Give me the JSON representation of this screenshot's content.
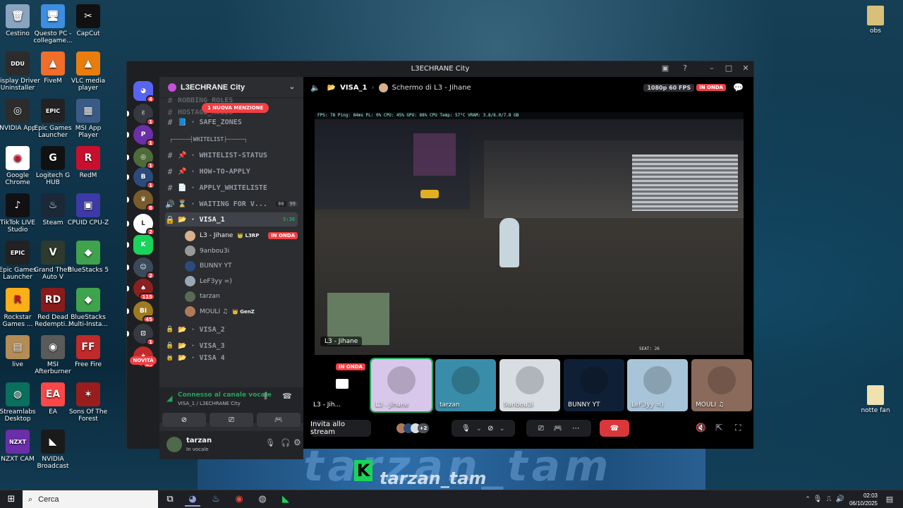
{
  "desktop": {
    "left_icons": [
      {
        "label": "Cestino",
        "icon": "recycle-bin-icon",
        "bg": "#8aa4c0",
        "glyph": "🗑"
      },
      {
        "label": "Questo PC - collegame...",
        "icon": "computer-icon",
        "bg": "#3d8de0",
        "glyph": "🖥"
      },
      {
        "label": "CapCut",
        "icon": "capcut-icon",
        "bg": "#111111",
        "glyph": "✂"
      },
      {
        "label": "Display Driver Uninstaller",
        "icon": "ddu-icon",
        "bg": "#2c2c2c",
        "glyph": "DDU"
      },
      {
        "label": "FiveM",
        "icon": "fivem-icon",
        "bg": "#f06d2a",
        "glyph": "▲"
      },
      {
        "label": "VLC media player",
        "icon": "vlc-icon",
        "bg": "#e87d0d",
        "glyph": "▲"
      },
      {
        "label": "NVIDIA App",
        "icon": "nvidia-icon",
        "bg": "#2c2c2c",
        "glyph": "◎"
      },
      {
        "label": "Epic Games Launcher",
        "icon": "epic-games-icon",
        "bg": "#222222",
        "glyph": "EPIC"
      },
      {
        "label": "MSI App Player",
        "icon": "msi-app-player-icon",
        "bg": "#3b5a85",
        "glyph": "▦"
      },
      {
        "label": "Google Chrome",
        "icon": "chrome-icon",
        "bg": "#ffffff",
        "glyph": "◉"
      },
      {
        "label": "Logitech G HUB",
        "icon": "logitech-icon",
        "bg": "#111111",
        "glyph": "G"
      },
      {
        "label": "RedM",
        "icon": "redm-icon",
        "bg": "#c8102e",
        "glyph": "R"
      },
      {
        "label": "TikTok LIVE Studio",
        "icon": "tiktok-icon",
        "bg": "#111111",
        "glyph": "♪"
      },
      {
        "label": "Steam",
        "icon": "steam-icon",
        "bg": "#1b2838",
        "glyph": "♨"
      },
      {
        "label": "CPUID CPU-Z",
        "icon": "cpuz-icon",
        "bg": "#3d3aa8",
        "glyph": "▣"
      },
      {
        "label": "Epic Games Launcher",
        "icon": "epic-games-icon",
        "bg": "#222222",
        "glyph": "EPIC"
      },
      {
        "label": "Grand Theft Auto V",
        "icon": "gta-icon",
        "bg": "#2d3a2d",
        "glyph": "V"
      },
      {
        "label": "BlueStacks 5",
        "icon": "bluestacks-icon",
        "bg": "#3fa34d",
        "glyph": "◆"
      },
      {
        "label": "Rockstar Games ...",
        "icon": "rockstar-icon",
        "bg": "#fcaf17",
        "glyph": "R"
      },
      {
        "label": "Red Dead Redempti...",
        "icon": "rdr-icon",
        "bg": "#8b1a1a",
        "glyph": "RD"
      },
      {
        "label": "BlueStacks Multi-Insta...",
        "icon": "bluestacks-multi-icon",
        "bg": "#3fa34d",
        "glyph": "◆"
      },
      {
        "label": "live",
        "icon": "folder-icon",
        "bg": "#b38c57",
        "glyph": "▤"
      },
      {
        "label": "MSI Afterburner",
        "icon": "msi-afterburner-icon",
        "bg": "#5a5a5a",
        "glyph": "◉"
      },
      {
        "label": "Free Fire",
        "icon": "free-fire-icon",
        "bg": "#c02a2a",
        "glyph": "FF"
      },
      {
        "label": "Streamlabs Desktop",
        "icon": "streamlabs-icon",
        "bg": "#0a6f5d",
        "glyph": "◍"
      },
      {
        "label": "EA",
        "icon": "ea-icon",
        "bg": "#ff4747",
        "glyph": "EA"
      },
      {
        "label": "Sons Of The Forest",
        "icon": "sotf-icon",
        "bg": "#9a1d1d",
        "glyph": "✶"
      },
      {
        "label": "NZXT CAM",
        "icon": "nzxt-icon",
        "bg": "#6a2ea8",
        "glyph": "NZXT"
      },
      {
        "label": "NVIDIA Broadcast",
        "icon": "nvidia-broadcast-icon",
        "bg": "#1a1a1a",
        "glyph": "◣"
      }
    ],
    "right_icons": [
      {
        "label": "obs",
        "icon": "folder-icon"
      },
      {
        "label": "notte fan",
        "icon": "folder-icon"
      }
    ],
    "banner_text": "tarzan_tam"
  },
  "discord": {
    "window_title": "L3ECHRANE City",
    "server_name": "L3ECHRANE City",
    "rail": [
      {
        "icon": "discord-home-icon",
        "bg": "#5865f2",
        "badge": "4",
        "glyph": "◕"
      },
      {
        "icon": "server-icon-1",
        "bg": "#36393f",
        "badge": "1",
        "glyph": "✌"
      },
      {
        "icon": "server-icon-2",
        "bg": "#6b2fa8",
        "badge": "1",
        "glyph": "P"
      },
      {
        "icon": "server-icon-3",
        "bg": "#4e6b3a",
        "badge": "1",
        "glyph": "◎"
      },
      {
        "icon": "server-icon-4",
        "bg": "#2c4a7a",
        "badge": "1",
        "glyph": "B"
      },
      {
        "icon": "server-icon-5",
        "bg": "#7a5b2c",
        "badge": "6",
        "glyph": "♛"
      },
      {
        "icon": "server-icon-6",
        "bg": "#ffffff",
        "badge": "2",
        "glyph": "L"
      },
      {
        "icon": "server-icon-kick",
        "bg": "#19d35b",
        "badge": "",
        "glyph": "K"
      },
      {
        "icon": "server-icon-7",
        "bg": "#3a4a5a",
        "badge": "2",
        "glyph": "☺"
      },
      {
        "icon": "server-icon-8",
        "bg": "#8a2020",
        "badge": "115",
        "glyph": "♠"
      },
      {
        "icon": "server-icon-9",
        "bg": "#a07a20",
        "badge": "45",
        "glyph": "BI"
      },
      {
        "icon": "server-icon-10",
        "bg": "#36393f",
        "badge": "1",
        "glyph": "⊡"
      },
      {
        "icon": "server-icon-11",
        "bg": "#c02a2a",
        "badge": "43",
        "glyph": "★"
      }
    ],
    "mention_banner": "1 NUOVA MENZIONE",
    "hidden_channels": [
      "ROBBING_ROLES",
      "HOSTAGE_ROLES"
    ],
    "channels": [
      {
        "kind": "#",
        "label": "📘 · SAFE_ZONES",
        "name": "safe-zones"
      },
      {
        "kind": "",
        "label": "┌─────┤WHITELIST├─────┐",
        "name": "category-whitelist"
      },
      {
        "kind": "#",
        "label": "📌 · WHITELIST-STATUS",
        "name": "whitelist-status"
      },
      {
        "kind": "#",
        "label": "📌 · HOW-TO-APPLY",
        "name": "how-to-apply"
      },
      {
        "kind": "#",
        "label": "📄 · APPLY_WHITELISTE",
        "name": "apply-whiteliste"
      },
      {
        "kind": "🔊",
        "label": "⌛ · WAITING FOR V...",
        "name": "waiting-for-voice",
        "extra_a": "00",
        "extra_b": "99"
      },
      {
        "kind": "🔒",
        "label": "📂 · VISA_1",
        "name": "visa-1",
        "timer": "5:30"
      }
    ],
    "voice_users": [
      {
        "name": "L3 - Jihane",
        "tag": "👑 L3RP",
        "live": "IN ONDA",
        "color": "#d9b08c"
      },
      {
        "name": "9anbou3i",
        "tag": "",
        "live": "",
        "color": "#999999"
      },
      {
        "name": "BUNNY YT",
        "tag": "",
        "live": "",
        "color": "#2c4a7a"
      },
      {
        "name": "LeF3yy =)",
        "tag": "",
        "live": "",
        "color": "#9aa7b5"
      },
      {
        "name": "tarzan",
        "tag": "",
        "live": "",
        "color": "#5a6a55"
      },
      {
        "name": "MOULI ♫",
        "tag": "👑 GenZ",
        "live": "",
        "color": "#b07a5a"
      }
    ],
    "locked_channels": [
      "📂 · VISA_2",
      "📂 · VISA_3",
      "📂 · VISA_4"
    ],
    "voice_panel": {
      "status": "Connesso al canale vocale",
      "location": "VISA_1 / L3ECHRANE City"
    },
    "user": {
      "name": "tarzan",
      "status": "In vocale"
    },
    "stream": {
      "channel": "VISA_1",
      "screen_title": "Schermo di L3 - Jihane",
      "quality": "1080p 60 FPS",
      "live": "IN ONDA",
      "overlay_name": "L3 - Jihane",
      "hud_stats": "FPS: 78   Ping: 84ms   PL: 0%   CPU: 45%   GPU: 88%   CPU Temp: 57°C   VRAM: 3.8/6.0/7.8 GB",
      "speed_text": "SEAT: 26"
    },
    "tiles": [
      {
        "name": "L3 - Jih...",
        "live": "IN ONDA",
        "kind": "screen"
      },
      {
        "name": "L3 - Jihane",
        "bg": "#d8c7ea",
        "highlight": true
      },
      {
        "name": "tarzan",
        "bg": "#3a8da8"
      },
      {
        "name": "9anbou3i",
        "bg": "#d7dde2"
      },
      {
        "name": "BUNNY YT",
        "bg": "#0f2036"
      },
      {
        "name": "LeF3yy =)",
        "bg": "#a8c4d8"
      },
      {
        "name": "MOULI ♫",
        "bg": "#8a6a5a"
      }
    ],
    "controls": {
      "invite_label": "Invita allo stream",
      "extra_count": "+2"
    }
  },
  "taskbar": {
    "search_placeholder": "Cerca",
    "time": "02:03",
    "date": "06/10/2025"
  }
}
